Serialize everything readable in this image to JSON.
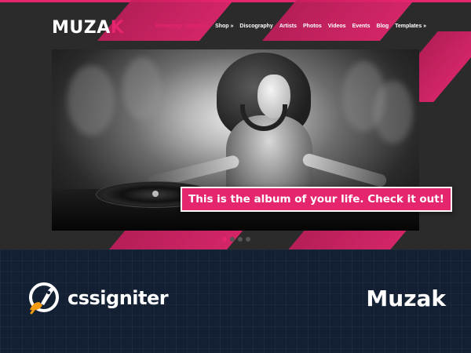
{
  "site": {
    "logo_main": "MUZA",
    "logo_accent": "K",
    "nav": [
      {
        "label": "Homepage layouts »",
        "active": true
      },
      {
        "label": "Shop »",
        "active": false
      },
      {
        "label": "Discography",
        "active": false
      },
      {
        "label": "Artists",
        "active": false
      },
      {
        "label": "Photos",
        "active": false
      },
      {
        "label": "Videos",
        "active": false
      },
      {
        "label": "Events",
        "active": false
      },
      {
        "label": "Blog",
        "active": false
      },
      {
        "label": "Templates »",
        "active": false
      }
    ],
    "slider_caption": "This is the album of your life. Check it out!",
    "slider_dots": {
      "count": 4,
      "active_index": 0
    }
  },
  "footer": {
    "brand_name": "cssigniter",
    "product_name": "Muzak"
  },
  "colors": {
    "accent": "#e6256f",
    "dark_bg": "#2b2b2b",
    "footer_bg": "#132033",
    "rocket_orange": "#f39c12"
  },
  "icons": {
    "brand_logo": "rocket-icon"
  }
}
